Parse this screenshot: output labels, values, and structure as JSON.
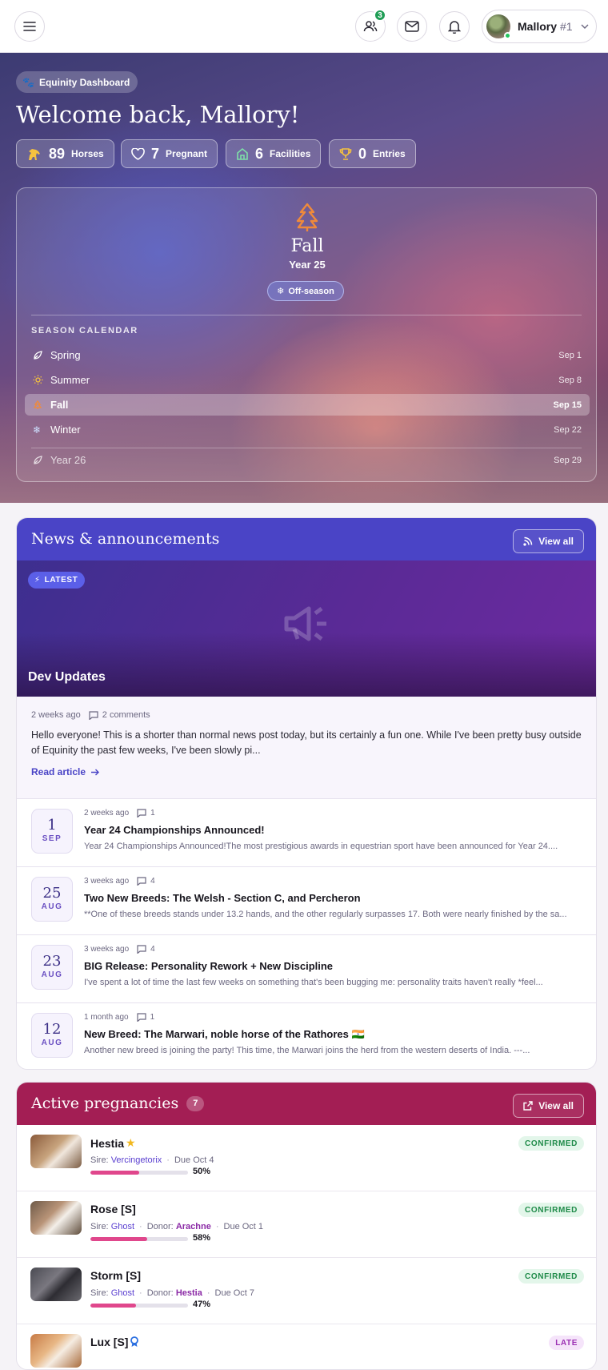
{
  "topbar": {
    "notifications_count": "3",
    "user_name": "Mallory",
    "user_rank": "#1"
  },
  "hero": {
    "badge": "Equinity Dashboard",
    "welcome": "Welcome back, Mallory!",
    "stats": [
      {
        "value": "89",
        "label": "Horses",
        "icon": "horse-icon"
      },
      {
        "value": "7",
        "label": "Pregnant",
        "icon": "heart-icon"
      },
      {
        "value": "6",
        "label": "Facilities",
        "icon": "facility-icon"
      },
      {
        "value": "0",
        "label": "Entries",
        "icon": "trophy-icon"
      }
    ],
    "season": {
      "name": "Fall",
      "year": "Year 25",
      "status": "Off-season",
      "calendar_title": "SEASON CALENDAR",
      "calendar": [
        {
          "name": "Spring",
          "date": "Sep 1",
          "icon": "leaf-icon"
        },
        {
          "name": "Summer",
          "date": "Sep 8",
          "icon": "sun-icon"
        },
        {
          "name": "Fall",
          "date": "Sep 15",
          "icon": "tree-icon"
        },
        {
          "name": "Winter",
          "date": "Sep 22",
          "icon": "snowflake-icon"
        },
        {
          "name": "Year 26",
          "date": "Sep 29",
          "icon": "leaf-icon"
        }
      ]
    }
  },
  "news": {
    "title": "News & announcements",
    "view_all": "View all",
    "latest_label": "LATEST",
    "featured": {
      "title": "Dev Updates",
      "time": "2 weeks ago",
      "comments": "2 comments",
      "body": "Hello everyone! This is a shorter than normal news post today, but its certainly a fun one. While I've been pretty busy outside of Equinity the past few weeks, I've been slowly pi...",
      "read_more": "Read article"
    },
    "items": [
      {
        "day": "1",
        "month": "SEP",
        "time": "2 weeks ago",
        "comments": "1",
        "title": "Year 24 Championships Announced!",
        "excerpt": "Year 24 Championships Announced!The most prestigious awards in equestrian sport have been announced for Year 24...."
      },
      {
        "day": "25",
        "month": "AUG",
        "time": "3 weeks ago",
        "comments": "4",
        "title": "Two New Breeds: The Welsh - Section C, and Percheron",
        "excerpt": "**One of these breeds stands under 13.2 hands, and the other regularly surpasses 17. Both were nearly finished by the sa..."
      },
      {
        "day": "23",
        "month": "AUG",
        "time": "3 weeks ago",
        "comments": "4",
        "title": "BIG Release: Personality Rework + New Discipline",
        "excerpt": "I've spent a lot of time the last few weeks on something that's been bugging me: personality traits haven't really *feel..."
      },
      {
        "day": "12",
        "month": "AUG",
        "time": "1 month ago",
        "comments": "1",
        "title": "New Breed: The Marwari, noble horse of the Rathores 🇮🇳",
        "excerpt": "Another new breed is joining the party! This time, the Marwari joins the herd from the western deserts of India. ---..."
      }
    ]
  },
  "pregnancies": {
    "title": "Active pregnancies",
    "count": "7",
    "view_all": "View all",
    "sire_label": "Sire:",
    "donor_label": "Donor:",
    "items": [
      {
        "name": "Hestia",
        "badge_icon": "star-icon",
        "sire": "Vercingetorix",
        "donor": "",
        "due": "Due Oct 4",
        "progress": 50,
        "progress_label": "50%",
        "status": "CONFIRMED",
        "color": "#c8a47e"
      },
      {
        "name": "Rose [S]",
        "badge_icon": "",
        "sire": "Ghost",
        "donor": "Arachne",
        "due": "Due Oct 1",
        "progress": 58,
        "progress_label": "58%",
        "status": "CONFIRMED",
        "color": "#b99478"
      },
      {
        "name": "Storm [S]",
        "badge_icon": "",
        "sire": "Ghost",
        "donor": "Hestia",
        "due": "Due Oct 7",
        "progress": 47,
        "progress_label": "47%",
        "status": "CONFIRMED",
        "color": "#6b6a70"
      },
      {
        "name": "Lux [S]",
        "badge_icon": "ribbon-icon",
        "sire": "",
        "donor": "",
        "due": "",
        "progress": null,
        "progress_label": "",
        "status": "LATE",
        "color": "#d9a070"
      }
    ]
  }
}
